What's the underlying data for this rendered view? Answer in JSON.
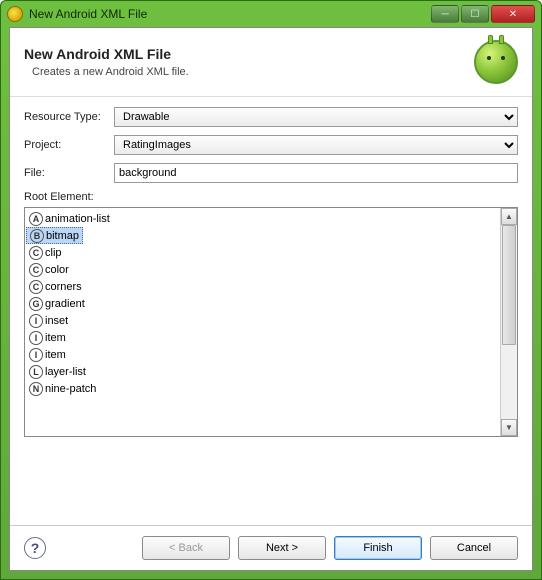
{
  "window": {
    "title": "New Android XML File"
  },
  "header": {
    "title": "New Android XML File",
    "subtitle": "Creates a new Android XML file."
  },
  "form": {
    "resource_type_label": "Resource Type:",
    "resource_type_value": "Drawable",
    "project_label": "Project:",
    "project_value": "RatingImages",
    "file_label": "File:",
    "file_value": "background"
  },
  "root": {
    "label": "Root Element:",
    "items": [
      {
        "letter": "A",
        "name": "animation-list"
      },
      {
        "letter": "B",
        "name": "bitmap",
        "selected": true
      },
      {
        "letter": "C",
        "name": "clip"
      },
      {
        "letter": "C",
        "name": "color"
      },
      {
        "letter": "C",
        "name": "corners"
      },
      {
        "letter": "G",
        "name": "gradient"
      },
      {
        "letter": "I",
        "name": "inset"
      },
      {
        "letter": "I",
        "name": "item"
      },
      {
        "letter": "I",
        "name": "item"
      },
      {
        "letter": "L",
        "name": "layer-list"
      },
      {
        "letter": "N",
        "name": "nine-patch"
      }
    ]
  },
  "buttons": {
    "back": "< Back",
    "next": "Next >",
    "finish": "Finish",
    "cancel": "Cancel"
  }
}
